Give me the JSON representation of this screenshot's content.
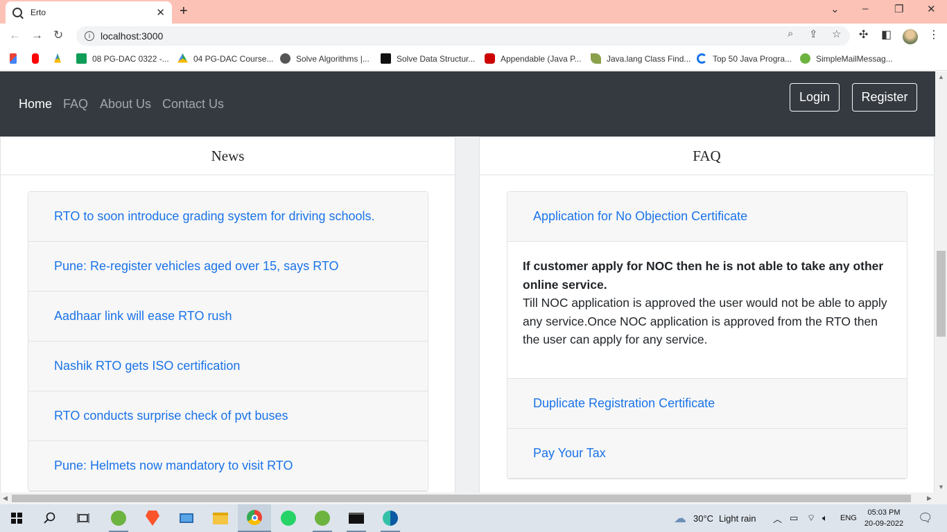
{
  "browser": {
    "tab_title": "Erto",
    "new_tab": "+",
    "close_tab": "✕",
    "url": "localhost:3000",
    "bookmarks": [
      {
        "label": "",
        "icon": "gmail-icon"
      },
      {
        "label": "",
        "icon": "youtube-icon"
      },
      {
        "label": "",
        "icon": "drive-icon"
      },
      {
        "label": "08 PG-DAC 0322 -...",
        "icon": "sheets-icon"
      },
      {
        "label": "04 PG-DAC Course...",
        "icon": "drive-icon"
      },
      {
        "label": "Solve Algorithms |...",
        "icon": "globe-icon"
      },
      {
        "label": "Solve Data Structur...",
        "icon": "hackerrank-icon"
      },
      {
        "label": "Appendable (Java P...",
        "icon": "oracle-icon"
      },
      {
        "label": "Java.lang Class Find...",
        "icon": "leaf-icon"
      },
      {
        "label": "Top 50 Java Progra...",
        "icon": "refresh-blue-icon"
      },
      {
        "label": "SimpleMailMessag...",
        "icon": "spring-icon"
      }
    ]
  },
  "nav": {
    "links": [
      "Home",
      "FAQ",
      "About Us",
      "Contact Us"
    ],
    "login": "Login",
    "register": "Register"
  },
  "news": {
    "title": "News",
    "items": [
      "RTO to soon introduce grading system for driving schools.",
      "Pune: Re-register vehicles aged over 15, says RTO",
      "Aadhaar link will ease RTO rush",
      "Nashik RTO gets ISO certification",
      "RTO conducts surprise check of pvt buses",
      "Pune: Helmets now mandatory to visit RTO"
    ]
  },
  "faq": {
    "title": "FAQ",
    "items": [
      {
        "question": "Application for No Objection Certificate",
        "answer_bold": "If customer apply for NOC then he is not able to take any other online service.",
        "answer": "Till NOC application is approved the user would not be able to apply any service.Once NOC application is approved from the RTO then the user can apply for any service."
      },
      {
        "question": "Duplicate Registration Certificate"
      },
      {
        "question": "Pay Your Tax"
      }
    ]
  },
  "taskbar": {
    "weather_temp": "30°C",
    "weather_text": "Light rain",
    "lang": "ENG",
    "time": "05:03 PM",
    "date": "20-09-2022"
  },
  "colors": {
    "tabbar": "#fcc2b6",
    "navbar": "#343a40",
    "link": "#1a73e8"
  }
}
